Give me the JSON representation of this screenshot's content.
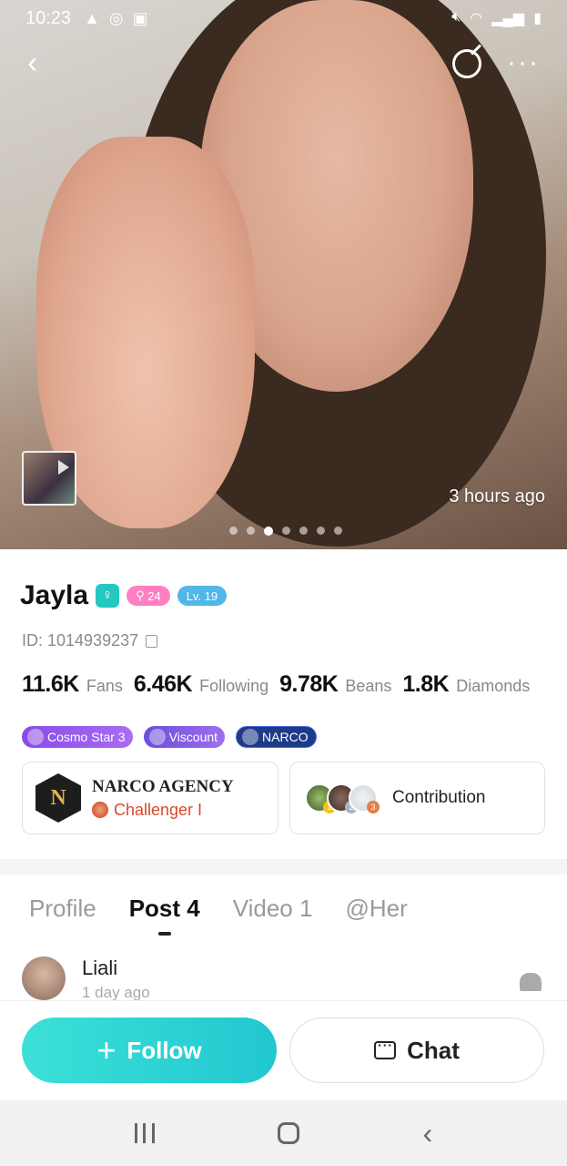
{
  "status_bar": {
    "time": "10:23"
  },
  "hero": {
    "time_ago": "3 hours ago",
    "dots_count": 7,
    "active_dot": 2
  },
  "profile": {
    "name": "Jayla",
    "gender_badge": "24",
    "level": "Lv. 19",
    "id_text": "ID: 1014939237",
    "stats": [
      {
        "value": "11.6K",
        "label": "Fans"
      },
      {
        "value": "6.46K",
        "label": "Following"
      },
      {
        "value": "9.78K",
        "label": "Beans"
      },
      {
        "value": "1.8K",
        "label": "Diamonds"
      }
    ],
    "medals": [
      {
        "label": "Cosmo Star 3"
      },
      {
        "label": "Viscount"
      },
      {
        "label": "NARCO"
      }
    ],
    "agency": {
      "name": "NARCO AGENCY",
      "rank": "Challenger I"
    },
    "contribution": {
      "label": "Contribution",
      "ranks": [
        "1",
        "2",
        "3"
      ]
    }
  },
  "tabs": [
    {
      "label": "Profile"
    },
    {
      "label": "Post 4"
    },
    {
      "label": "Video 1"
    },
    {
      "label": "@Her"
    }
  ],
  "post": {
    "name": "Liali",
    "time": "1 day ago"
  },
  "actions": {
    "follow_label": "Follow",
    "chat_label": "Chat"
  },
  "colors": {
    "accent": "#21c7cf",
    "follow_gradient_start": "#3ce0d8"
  }
}
